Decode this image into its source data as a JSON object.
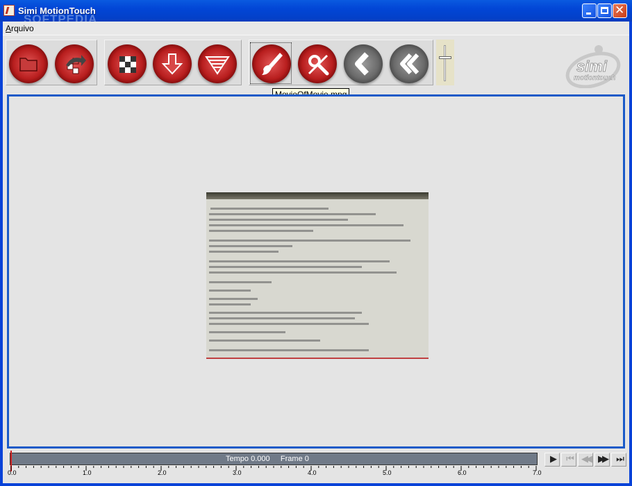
{
  "window": {
    "title": "Simi MotionTouch",
    "watermark": "SOFTPEDIA"
  },
  "menu": {
    "items": [
      {
        "mnemonic": "A",
        "rest": "rquivo"
      }
    ]
  },
  "toolbar": {
    "groups": [
      {
        "buttons": [
          {
            "icon": "folder-icon"
          },
          {
            "icon": "share-arrow-icon"
          }
        ]
      },
      {
        "buttons": [
          {
            "icon": "checker-grid-icon"
          },
          {
            "icon": "download-arrow-icon"
          },
          {
            "icon": "striped-triangle-icon"
          }
        ]
      },
      {
        "buttons": [
          {
            "icon": "brush-icon",
            "focused": true
          },
          {
            "icon": "eraser-icon"
          },
          {
            "icon": "back-icon"
          },
          {
            "icon": "rewind-icon"
          }
        ]
      }
    ]
  },
  "logo": {
    "name": "simi",
    "tagline": "motiontouch"
  },
  "tooltip": {
    "text": "MovieOfMovie.mpg"
  },
  "timeline": {
    "tempo_label": "Tempo",
    "tempo_value": "0.000",
    "frame_label": "Frame",
    "frame_value": "0",
    "ticks": [
      "0.0",
      "1.0",
      "2.0",
      "3.0",
      "4.0",
      "5.0",
      "6.0",
      "7.0"
    ],
    "max_seconds": 7.0,
    "position_seconds": 0.0
  },
  "transport": {
    "buttons": [
      {
        "icon": "play-icon",
        "glyph": "▶",
        "enabled": true
      },
      {
        "icon": "skip-to-start-icon",
        "glyph": "⏮",
        "enabled": false
      },
      {
        "icon": "step-back-icon",
        "glyph": "◀◀",
        "enabled": false
      },
      {
        "icon": "fast-forward-icon",
        "glyph": "▶▶",
        "enabled": true
      },
      {
        "icon": "skip-to-end-icon",
        "glyph": "⏭",
        "enabled": true
      }
    ]
  },
  "colors": {
    "titlebar": "#0842d8",
    "panel_border": "#1a5ac8",
    "button_red": "#b81e1e",
    "tooltip_bg": "#ffffe1"
  }
}
